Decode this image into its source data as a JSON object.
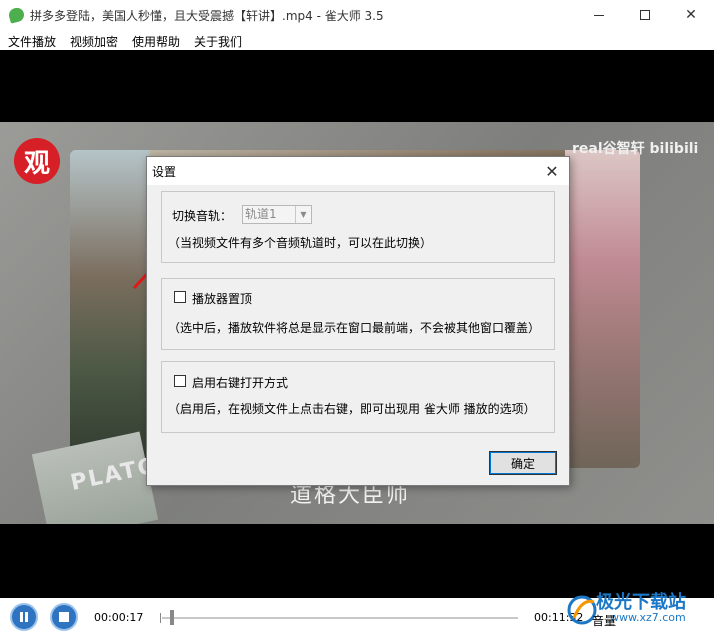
{
  "window": {
    "title": "拼多多登陆，美国人秒懂，且大受震撼【轩讲】.mp4 - 雀大师 3.5",
    "controls": {
      "close": "✕"
    }
  },
  "menu": {
    "items": [
      "文件播放",
      "视频加密",
      "使用帮助",
      "关于我们"
    ]
  },
  "video": {
    "overlay_logo": "观",
    "watermark": "real谷智轩 bilibili",
    "subtitle": "道格大臣师",
    "book_text": "PLATO"
  },
  "dialog": {
    "title": "设置",
    "close": "✕",
    "audio": {
      "label": "切换音轨：",
      "selected": "轨道1",
      "hint": "（当视频文件有多个音频轨道时，可以在此切换）"
    },
    "on_top": {
      "label": "播放器置顶",
      "hint": "（选中后，播放软件将总是显示在窗口最前端，不会被其他窗口覆盖）",
      "checked": false
    },
    "context_menu": {
      "label": "启用右键打开方式",
      "hint": "（启用后，在视频文件上点击右键，即可出现用 雀大师 播放的选项）",
      "checked": false
    },
    "ok": "确定"
  },
  "player": {
    "current_time": "00:00:17",
    "total_time": "00:11:32",
    "volume_label": "音量",
    "site_name": "极光下载站",
    "site_url": "www.xz7.com"
  },
  "colors": {
    "accent": "#2f74c0",
    "arrow": "#e01818"
  }
}
